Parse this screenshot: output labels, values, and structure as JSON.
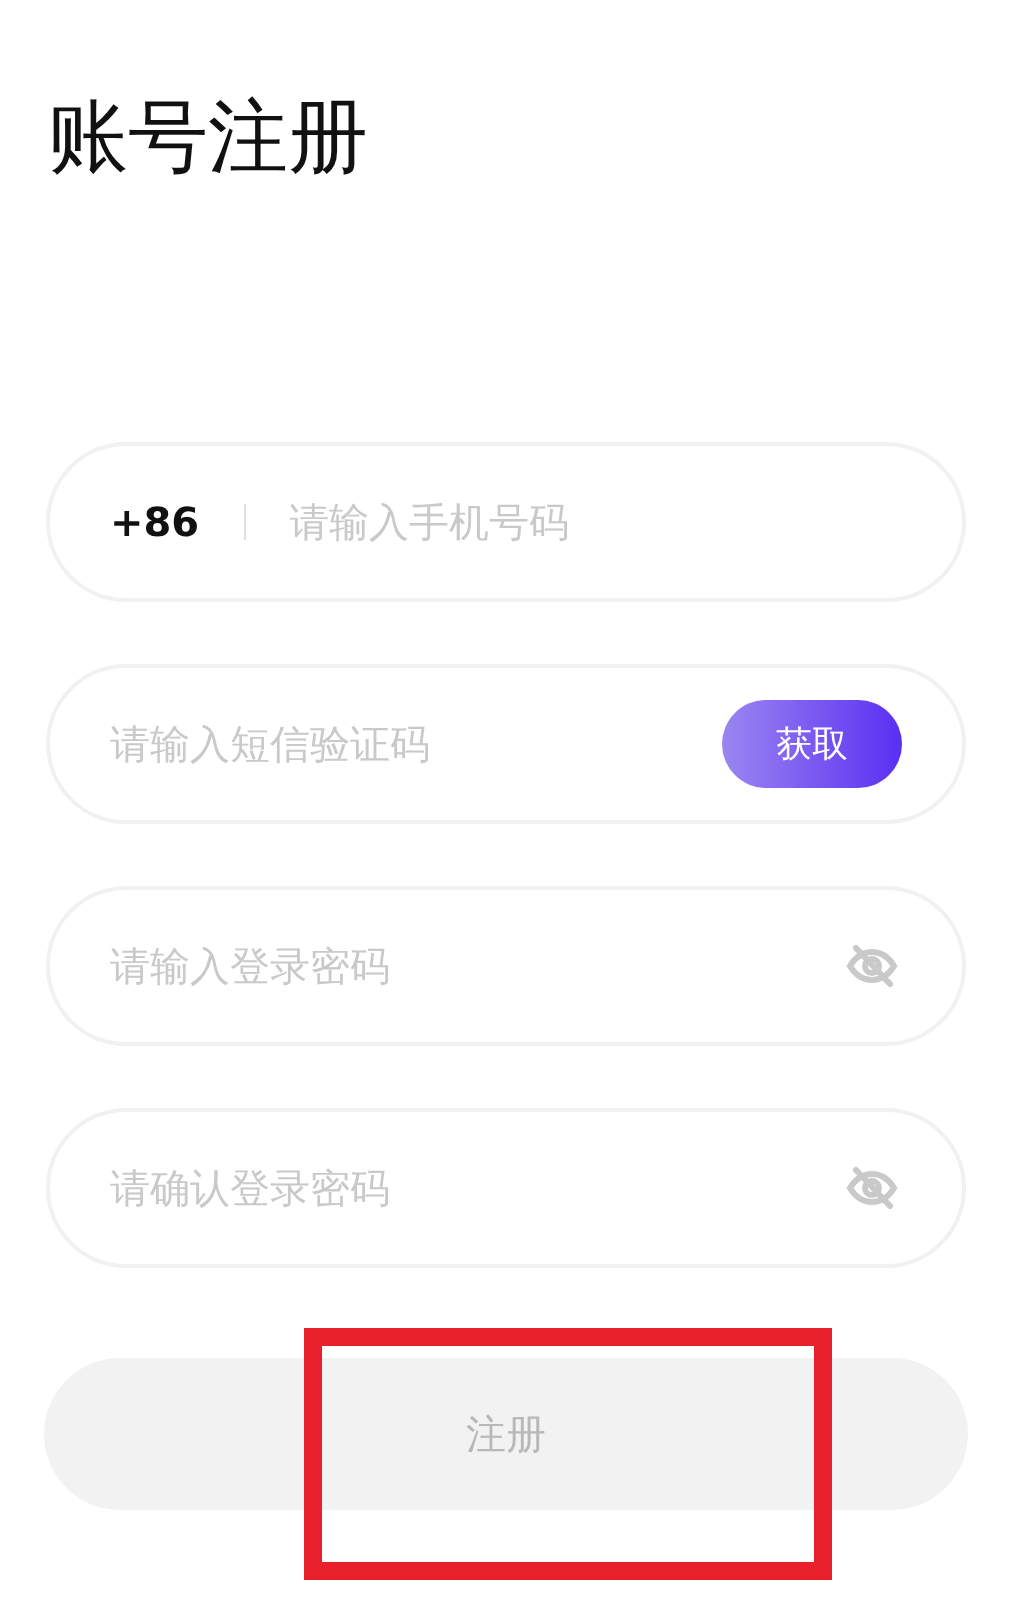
{
  "title": "账号注册",
  "fields": [
    {
      "kind": "phone",
      "prefix": "+86",
      "placeholder": "请输入手机号码"
    },
    {
      "kind": "code",
      "placeholder": "请输入短信验证码",
      "action": "获取"
    },
    {
      "kind": "password",
      "placeholder": "请输入登录密码"
    },
    {
      "kind": "password",
      "placeholder": "请确认登录密码"
    }
  ],
  "submit": {
    "label": "注册",
    "disabled": true
  },
  "highlight_box": {
    "shown": true
  }
}
